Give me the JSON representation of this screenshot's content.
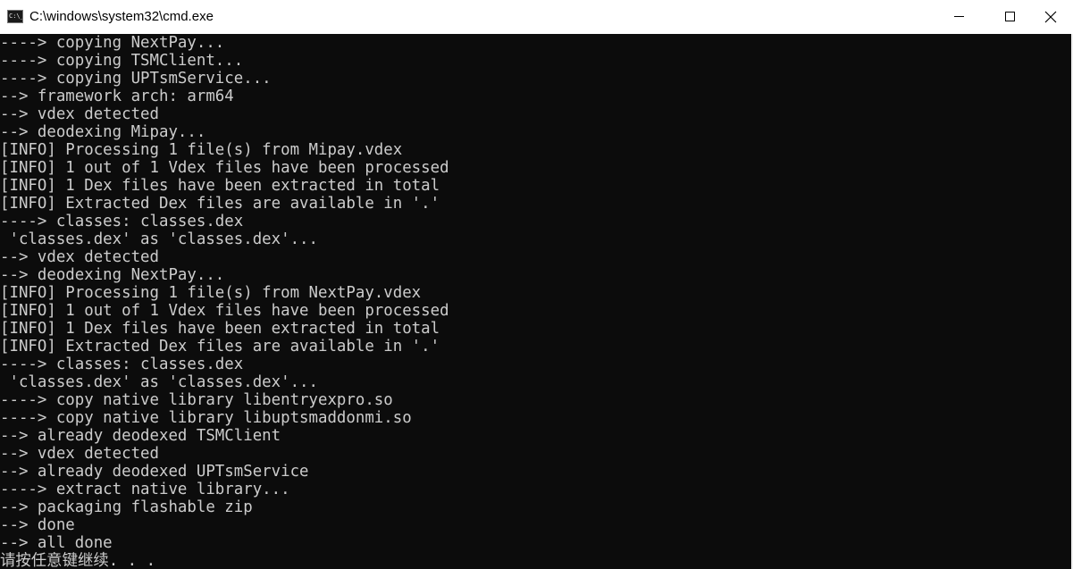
{
  "window": {
    "title": "C:\\windows\\system32\\cmd.exe",
    "icon_text": "C:\\_"
  },
  "icons": {
    "app": "cmd-icon",
    "minimize": "minimize-icon",
    "maximize": "maximize-icon",
    "close": "close-icon"
  },
  "colors": {
    "console_background": "#0c0c0c",
    "console_text": "#cccccc",
    "titlebar": "#ffffff"
  },
  "console": {
    "lines": [
      "----> copying NextPay...",
      "----> copying TSMClient...",
      "----> copying UPTsmService...",
      "--> framework arch: arm64",
      "--> vdex detected",
      "--> deodexing Mipay...",
      "[INFO] Processing 1 file(s) from Mipay.vdex",
      "[INFO] 1 out of 1 Vdex files have been processed",
      "[INFO] 1 Dex files have been extracted in total",
      "[INFO] Extracted Dex files are available in '.'",
      "----> classes: classes.dex",
      " 'classes.dex' as 'classes.dex'...",
      "--> vdex detected",
      "--> deodexing NextPay...",
      "[INFO] Processing 1 file(s) from NextPay.vdex",
      "[INFO] 1 out of 1 Vdex files have been processed",
      "[INFO] 1 Dex files have been extracted in total",
      "[INFO] Extracted Dex files are available in '.'",
      "----> classes: classes.dex",
      " 'classes.dex' as 'classes.dex'...",
      "----> copy native library libentryexpro.so",
      "----> copy native library libuptsmaddonmi.so",
      "--> already deodexed TSMClient",
      "--> vdex detected",
      "--> already deodexed UPTsmService",
      "----> extract native library...",
      "--> packaging flashable zip",
      "--> done",
      "--> all done",
      "请按任意键继续. . ."
    ]
  }
}
